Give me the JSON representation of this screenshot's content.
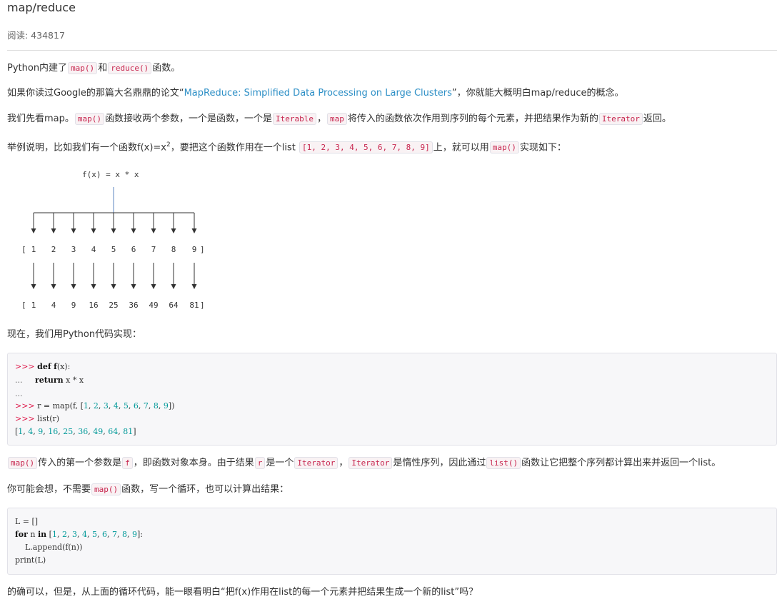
{
  "title": "map/reduce",
  "reads_label": "阅读: 434817",
  "p1": {
    "a": "Python内建了",
    "code1": "map()",
    "b": "和",
    "code2": "reduce()",
    "c": "函数。"
  },
  "p2": {
    "a": "如果你读过Google的那篇大名鼎鼎的论文“",
    "link": "MapReduce: Simplified Data Processing on Large Clusters",
    "b": "”，你就能大概明白map/reduce的概念。"
  },
  "p3": {
    "a": "我们先看map。",
    "code1": "map()",
    "b": "函数接收两个参数，一个是函数，一个是",
    "code2": "Iterable",
    "c": "，",
    "code3": "map",
    "d": "将传入的函数依次作用到序列的每个元素，并把结果作为新的",
    "code4": "Iterator",
    "e": "返回。"
  },
  "p4": {
    "a": "举例说明，比如我们有一个函数f(x)=x",
    "sup": "2",
    "b": "，要把这个函数作用在一个list ",
    "code1": "[1, 2, 3, 4, 5, 6, 7, 8, 9]",
    "c": "上，就可以用",
    "code2": "map()",
    "d": "实现如下："
  },
  "diagram": {
    "func_label": "f(x) = x * x",
    "inputs": [
      "1",
      "2",
      "3",
      "4",
      "5",
      "6",
      "7",
      "8",
      "9"
    ],
    "outputs": [
      "1",
      "4",
      "9",
      "16",
      "25",
      "36",
      "49",
      "64",
      "81"
    ],
    "open_bracket": "[",
    "close_bracket": "]"
  },
  "p5": {
    "a": "现在，我们用Python代码实现："
  },
  "code_block1": {
    "prompt": ">>>",
    "cont": "...",
    "line1_kw": "def",
    "line1_fn": "f",
    "line1_rest": "(x):",
    "line2_dots": "...",
    "line2_kw": "return",
    "line2_rest": " x * x",
    "line3": "...",
    "line4_a": " r = map(f, [",
    "line4_nums": [
      "1",
      "2",
      "3",
      "4",
      "5",
      "6",
      "7",
      "8",
      "9"
    ],
    "line4_b": "])",
    "line5": " list(r)",
    "line6_a": "[",
    "line6_nums": [
      "1",
      "4",
      "9",
      "16",
      "25",
      "36",
      "49",
      "64",
      "81"
    ],
    "line6_b": "]"
  },
  "p6": {
    "code1": "map()",
    "a": "传入的第一个参数是",
    "code2": "f",
    "b": "，即函数对象本身。由于结果",
    "code3": "r",
    "c": "是一个",
    "code4": "Iterator",
    "d": "，",
    "code5": "Iterator",
    "e": "是惰性序列，因此通过",
    "code6": "list()",
    "f": "函数让它把整个序列都计算出来并返回一个list。"
  },
  "p7": {
    "a": "你可能会想，不需要",
    "code1": "map()",
    "b": "函数，写一个循环，也可以计算出结果："
  },
  "code_block2": {
    "line1": "L = []",
    "line2_kw1": "for",
    "line2_a": " n ",
    "line2_kw2": "in",
    "line2_b": " [",
    "line2_nums": [
      "1",
      "2",
      "3",
      "4",
      "5",
      "6",
      "7",
      "8",
      "9"
    ],
    "line2_c": "]:",
    "line3": "    L.append(f(n))",
    "line4": "print(L)"
  },
  "p8": {
    "a": "的确可以，但是，从上面的循环代码，能一眼看明白“把f(x)作用在list的每一个元素并把结果生成一个新的list”吗？"
  }
}
